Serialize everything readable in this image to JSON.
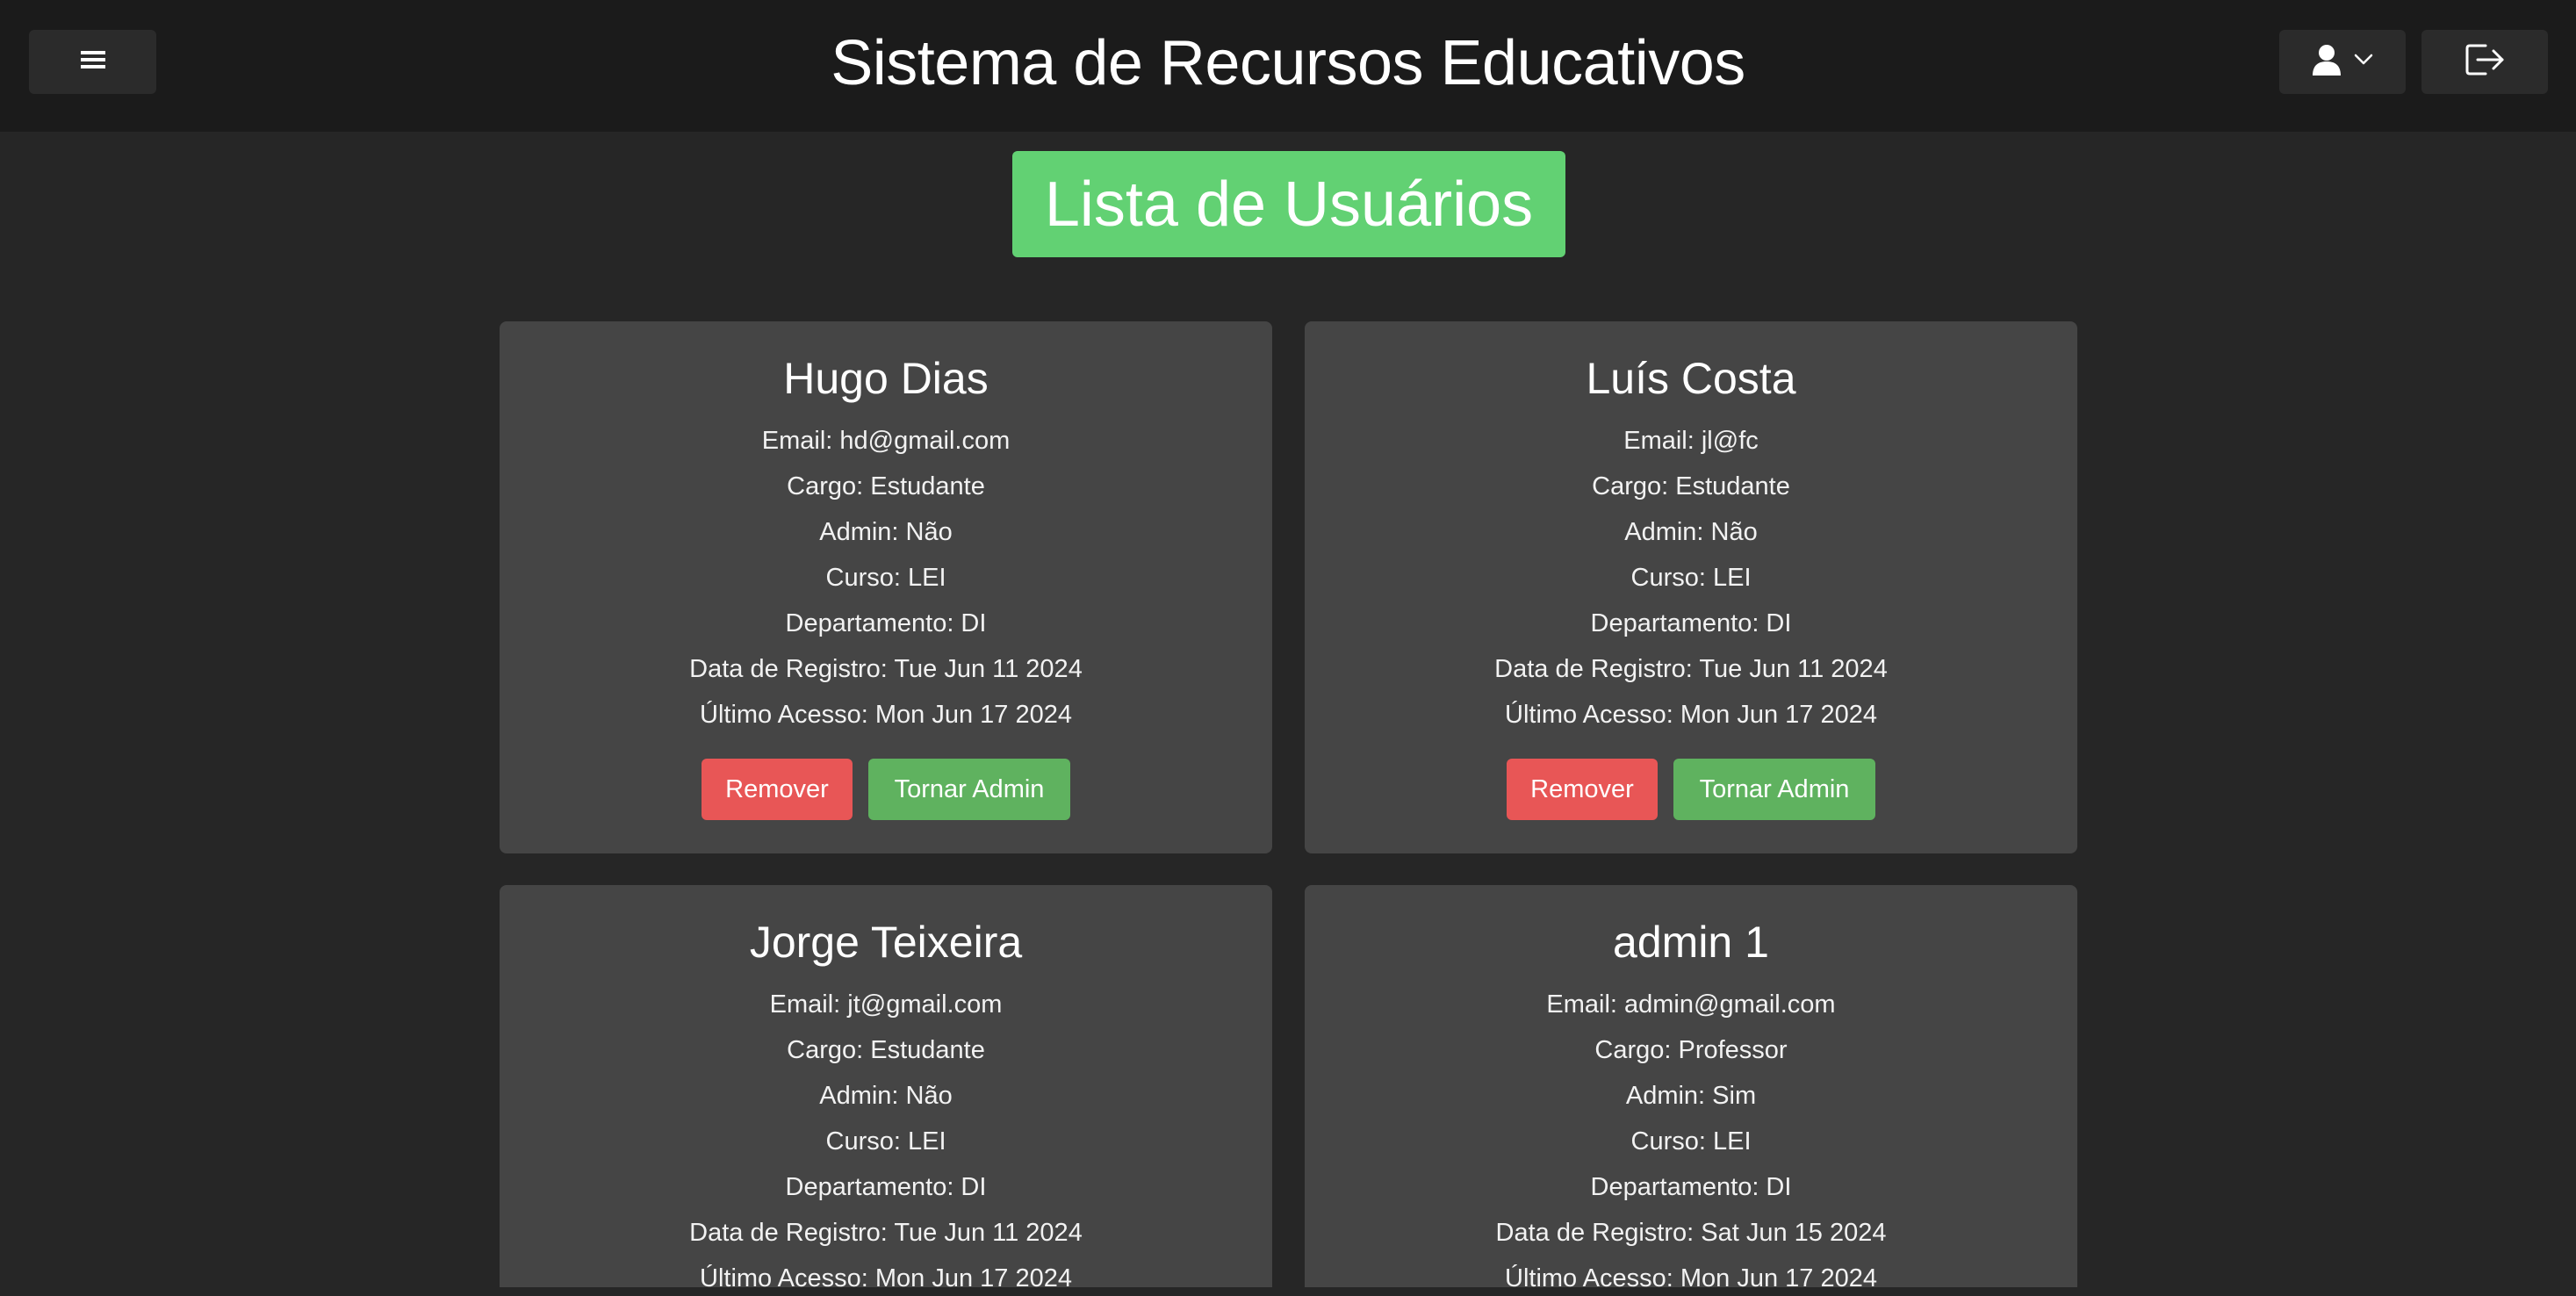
{
  "header": {
    "title": "Sistema de Recursos Educativos",
    "menu_icon": "hamburger-icon",
    "user_icon": "user-icon",
    "dropdown_icon": "chevron-down-icon",
    "logout_icon": "logout-icon"
  },
  "page": {
    "heading": "Lista de Usuários"
  },
  "users": [
    {
      "name": "Hugo Dias",
      "email": "Email: hd@gmail.com",
      "cargo": "Cargo: Estudante",
      "admin": "Admin: Não",
      "curso": "Curso: LEI",
      "departamento": "Departamento: DI",
      "registro": "Data de Registro: Tue Jun 11 2024",
      "acesso": "Último Acesso: Mon Jun 17 2024",
      "remove_label": "Remover",
      "admin_label": "Tornar Admin"
    },
    {
      "name": "Luís Costa",
      "email": "Email: jl@fc",
      "cargo": "Cargo: Estudante",
      "admin": "Admin: Não",
      "curso": "Curso: LEI",
      "departamento": "Departamento: DI",
      "registro": "Data de Registro: Tue Jun 11 2024",
      "acesso": "Último Acesso: Mon Jun 17 2024",
      "remove_label": "Remover",
      "admin_label": "Tornar Admin"
    },
    {
      "name": "Jorge Teixeira",
      "email": "Email: jt@gmail.com",
      "cargo": "Cargo: Estudante",
      "admin": "Admin: Não",
      "curso": "Curso: LEI",
      "departamento": "Departamento: DI",
      "registro": "Data de Registro: Tue Jun 11 2024",
      "acesso": "Último Acesso: Mon Jun 17 2024"
    },
    {
      "name": "admin 1",
      "email": "Email: admin@gmail.com",
      "cargo": "Cargo: Professor",
      "admin": "Admin: Sim",
      "curso": "Curso: LEI",
      "departamento": "Departamento: DI",
      "registro": "Data de Registro: Sat Jun 15 2024",
      "acesso": "Último Acesso: Mon Jun 17 2024"
    }
  ],
  "colors": {
    "background": "#262626",
    "topbar": "#1b1b1b",
    "card": "#454545",
    "heading_green": "#62d173",
    "remove_red": "#e85656",
    "admin_green": "#5fb25f"
  }
}
